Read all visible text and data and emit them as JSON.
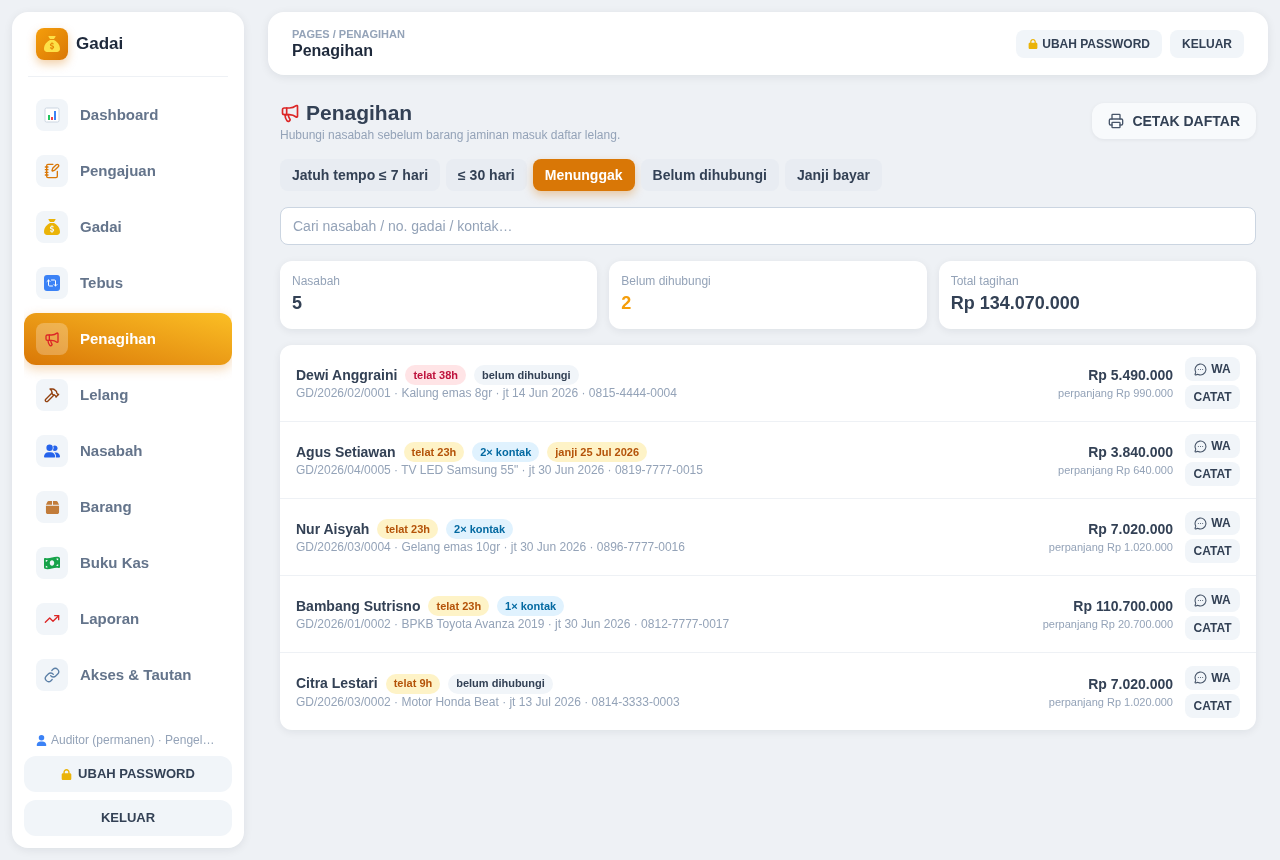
{
  "sidebar": {
    "brand": "Gadai",
    "items": [
      {
        "label": "Dashboard",
        "selected": false
      },
      {
        "label": "Pengajuan",
        "selected": false
      },
      {
        "label": "Gadai",
        "selected": false
      },
      {
        "label": "Tebus",
        "selected": false
      },
      {
        "label": "Penagihan",
        "selected": true
      },
      {
        "label": "Lelang",
        "selected": false
      },
      {
        "label": "Nasabah",
        "selected": false
      },
      {
        "label": "Barang",
        "selected": false
      },
      {
        "label": "Buku Kas",
        "selected": false
      },
      {
        "label": "Laporan",
        "selected": false
      },
      {
        "label": "Akses & Tautan",
        "selected": false
      }
    ],
    "user": "Auditor (permanen) · Pengel…",
    "buttons": [
      "UBAH PASSWORD",
      "KELUAR"
    ]
  },
  "topbar": {
    "breadcrumb": "PAGES / PENAGIHAN",
    "title": "Penagihan",
    "buttons": [
      "UBAH PASSWORD",
      "KELUAR"
    ]
  },
  "header": {
    "title": "Penagihan",
    "subtitle": "Hubungi nasabah sebelum barang jaminan masuk daftar lelang.",
    "print_button": "CETAK DAFTAR"
  },
  "tabs": [
    {
      "label": "Jatuh tempo ≤ 7 hari",
      "selected": false
    },
    {
      "label": "≤ 30 hari",
      "selected": false
    },
    {
      "label": "Menunggak",
      "selected": true
    },
    {
      "label": "Belum dihubungi",
      "selected": false
    },
    {
      "label": "Janji bayar",
      "selected": false
    }
  ],
  "search": {
    "placeholder": "Cari nasabah / no. gadai / kontak…"
  },
  "stats": [
    {
      "label": "Nasabah",
      "value": "5",
      "kind": "plain"
    },
    {
      "label": "Belum dihubungi",
      "value": "2",
      "kind": "warning"
    },
    {
      "label": "Total tagihan",
      "value": "Rp 134.070.000",
      "kind": "plain"
    }
  ],
  "billing_list": [
    {
      "name": "Dewi Anggraini",
      "tags": [
        {
          "text": "telat 38h",
          "kind": "danger"
        },
        {
          "text": "belum dihubungi",
          "kind": "neutral"
        }
      ],
      "details": "GD/2026/02/0001 · Kalung emas 8gr · jt 14 Jun 2026 · 0815-4444-0004",
      "amount": "Rp 5.490.000",
      "extension": "perpanjang Rp 990.000",
      "actions": [
        "WA",
        "CATAT"
      ]
    },
    {
      "name": "Agus Setiawan",
      "tags": [
        {
          "text": "telat 23h",
          "kind": "warning"
        },
        {
          "text": "2× kontak",
          "kind": "info"
        },
        {
          "text": "janji 25 Jul 2026",
          "kind": "warning"
        }
      ],
      "details": "GD/2026/04/0005 · TV LED Samsung 55\" · jt 30 Jun 2026 · 0819-7777-0015",
      "amount": "Rp 3.840.000",
      "extension": "perpanjang Rp 640.000",
      "actions": [
        "WA",
        "CATAT"
      ]
    },
    {
      "name": "Nur Aisyah",
      "tags": [
        {
          "text": "telat 23h",
          "kind": "warning"
        },
        {
          "text": "2× kontak",
          "kind": "info"
        }
      ],
      "details": "GD/2026/03/0004 · Gelang emas 10gr · jt 30 Jun 2026 · 0896-7777-0016",
      "amount": "Rp 7.020.000",
      "extension": "perpanjang Rp 1.020.000",
      "actions": [
        "WA",
        "CATAT"
      ]
    },
    {
      "name": "Bambang Sutrisno",
      "tags": [
        {
          "text": "telat 23h",
          "kind": "warning"
        },
        {
          "text": "1× kontak",
          "kind": "info"
        }
      ],
      "details": "GD/2026/01/0002 · BPKB Toyota Avanza 2019 · jt 30 Jun 2026 · 0812-7777-0017",
      "amount": "Rp 110.700.000",
      "extension": "perpanjang Rp 20.700.000",
      "actions": [
        "WA",
        "CATAT"
      ]
    },
    {
      "name": "Citra Lestari",
      "tags": [
        {
          "text": "telat 9h",
          "kind": "warning"
        },
        {
          "text": "belum dihubungi",
          "kind": "neutral"
        }
      ],
      "details": "GD/2026/03/0002 · Motor Honda Beat · jt 13 Jul 2026 · 0814-3333-0003",
      "amount": "Rp 7.020.000",
      "extension": "perpanjang Rp 1.020.000",
      "actions": [
        "WA",
        "CATAT"
      ]
    }
  ]
}
